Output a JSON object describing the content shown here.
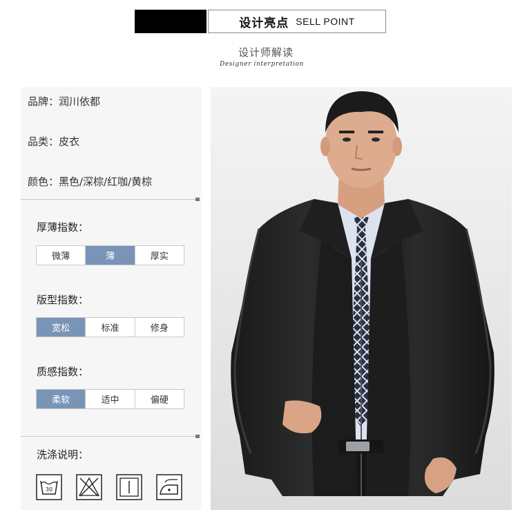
{
  "header": {
    "title_cn": "设计亮点",
    "title_en": "SELL POINT",
    "subtitle_cn": "设计师解读",
    "subtitle_en": "Designer interpretation"
  },
  "info": {
    "brand": "品牌：润川依都",
    "category": "品类：皮衣",
    "colors": "颜色：黑色/深棕/红咖/黄棕"
  },
  "indices": [
    {
      "label": "厚薄指数：",
      "options": [
        "微薄",
        "薄",
        "厚实"
      ],
      "selected": "薄"
    },
    {
      "label": "版型指数：",
      "options": [
        "宽松",
        "标准",
        "修身"
      ],
      "selected": "宽松"
    },
    {
      "label": "质感指数：",
      "options": [
        "柔软",
        "适中",
        "偏硬"
      ],
      "selected": "柔软"
    }
  ],
  "washing": {
    "label": "洗涤说明：",
    "temp": "30",
    "icons": [
      "wash-30-icon",
      "no-bleach-icon",
      "hang-dry-icon",
      "iron-low-icon"
    ]
  },
  "colors": {
    "accent": "#7894b7",
    "panel_bg": "#f6f6f6"
  },
  "photo": {
    "subject": "man-in-black-leather-jacket"
  }
}
